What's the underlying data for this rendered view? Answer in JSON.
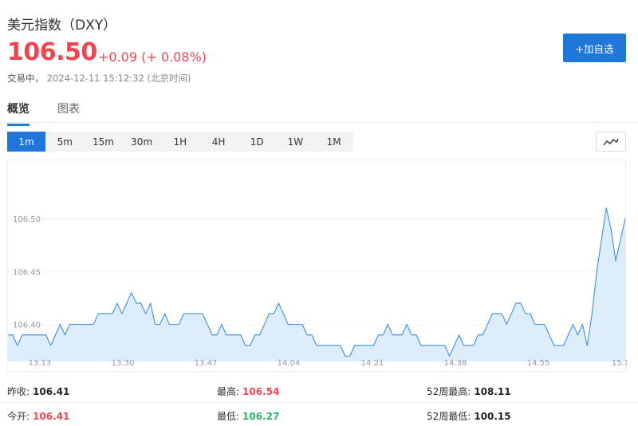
{
  "header": {
    "title": "美元指数（DXY）",
    "price": "106.50",
    "change": "+0.09",
    "change_pct": "(+ 0.08%)",
    "status": "交易中，",
    "timestamp": "2024-12-11 15:12:32",
    "tz": "(北京时间)"
  },
  "actions": {
    "add_watchlist": "+加自选"
  },
  "tabs": [
    {
      "label": "概览",
      "active": true
    },
    {
      "label": "图表",
      "active": false
    }
  ],
  "periods": [
    "1m",
    "5m",
    "15m",
    "30m",
    "1H",
    "4H",
    "1D",
    "1W",
    "1M"
  ],
  "active_period": "1m",
  "icons": {
    "chart_toggle": "line-chart-icon"
  },
  "colors": {
    "accent": "#1f77d9",
    "up": "#f0444f",
    "down": "#2cb36b",
    "line": "#3d8ede",
    "fill": "#deedfb"
  },
  "chart_data": {
    "type": "area",
    "ylim": [
      106.365,
      106.555
    ],
    "yticks": [
      106.4,
      106.45,
      106.5
    ],
    "ytick_labels": [
      "106.40",
      "106.45",
      "106.50"
    ],
    "xtick_labels": [
      "13.13",
      "13.30",
      "13.47",
      "14.04",
      "14.21",
      "14.38",
      "14.55",
      "15.1"
    ],
    "values": [
      106.39,
      106.39,
      106.38,
      106.39,
      106.39,
      106.39,
      106.39,
      106.39,
      106.39,
      106.38,
      106.39,
      106.4,
      106.39,
      106.4,
      106.4,
      106.4,
      106.4,
      106.4,
      106.4,
      106.41,
      106.41,
      106.41,
      106.41,
      106.42,
      106.41,
      106.42,
      106.43,
      106.42,
      106.42,
      106.41,
      106.42,
      106.4,
      106.4,
      106.41,
      106.4,
      106.4,
      106.4,
      106.41,
      106.41,
      106.41,
      106.41,
      106.41,
      106.4,
      106.39,
      106.39,
      106.4,
      106.39,
      106.39,
      106.39,
      106.39,
      106.38,
      106.38,
      106.39,
      106.39,
      106.4,
      106.41,
      106.41,
      106.42,
      106.41,
      106.4,
      106.4,
      106.4,
      106.4,
      106.39,
      106.39,
      106.38,
      106.38,
      106.38,
      106.38,
      106.38,
      106.38,
      106.37,
      106.37,
      106.38,
      106.38,
      106.38,
      106.38,
      106.38,
      106.39,
      106.39,
      106.4,
      106.39,
      106.39,
      106.39,
      106.4,
      106.39,
      106.39,
      106.38,
      106.38,
      106.38,
      106.38,
      106.38,
      106.38,
      106.37,
      106.38,
      106.39,
      106.38,
      106.38,
      106.38,
      106.39,
      106.39,
      106.4,
      106.41,
      106.41,
      106.41,
      106.4,
      106.41,
      106.42,
      106.42,
      106.41,
      106.41,
      106.4,
      106.4,
      106.4,
      106.39,
      106.38,
      106.38,
      106.38,
      106.39,
      106.4,
      106.39,
      106.4,
      106.38,
      106.41,
      106.45,
      106.48,
      106.51,
      106.49,
      106.46,
      106.48,
      106.5
    ]
  },
  "stats": {
    "prev_close_label": "昨收:",
    "prev_close": "106.41",
    "high_label": "最高:",
    "high": "106.54",
    "high52_label": "52周最高:",
    "high52": "108.11",
    "open_label": "今开:",
    "open": "106.41",
    "low_label": "最低:",
    "low": "106.27",
    "low52_label": "52周最低:",
    "low52": "100.15"
  }
}
